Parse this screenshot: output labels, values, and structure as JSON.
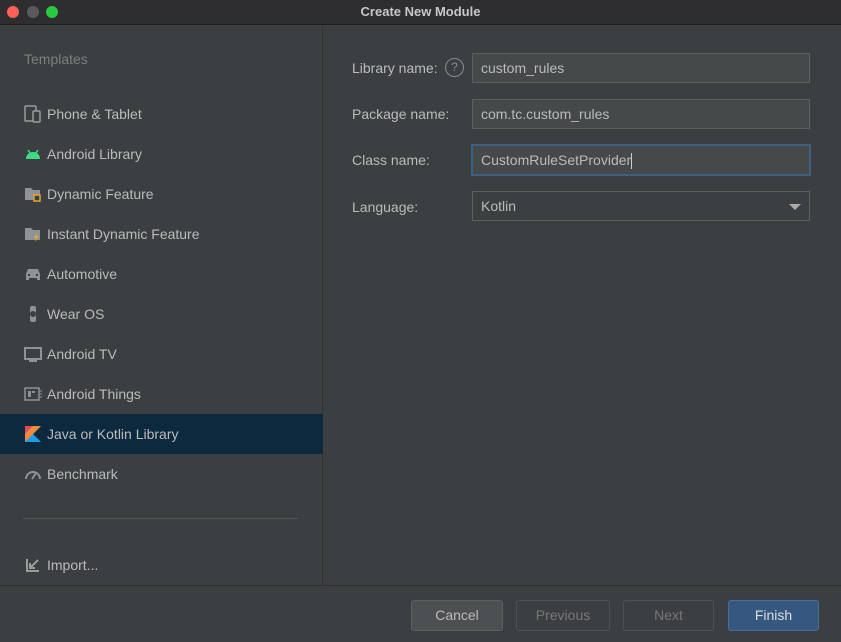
{
  "window": {
    "title": "Create New Module"
  },
  "sidebar": {
    "title": "Templates",
    "items": [
      {
        "label": "Phone & Tablet",
        "icon": "phone-tablet-icon"
      },
      {
        "label": "Android Library",
        "icon": "android-icon"
      },
      {
        "label": "Dynamic Feature",
        "icon": "dynamic-feature-folder-icon"
      },
      {
        "label": "Instant Dynamic Feature",
        "icon": "instant-feature-folder-icon"
      },
      {
        "label": "Automotive",
        "icon": "car-icon"
      },
      {
        "label": "Wear OS",
        "icon": "watch-icon"
      },
      {
        "label": "Android TV",
        "icon": "tv-icon"
      },
      {
        "label": "Android Things",
        "icon": "things-board-icon"
      },
      {
        "label": "Java or Kotlin Library",
        "icon": "kotlin-icon",
        "selected": true
      },
      {
        "label": "Benchmark",
        "icon": "gauge-icon"
      }
    ],
    "import_label": "Import..."
  },
  "form": {
    "library_name": {
      "label": "Library name:",
      "value": "custom_rules"
    },
    "package_name": {
      "label": "Package name:",
      "value": "com.tc.custom_rules"
    },
    "class_name": {
      "label": "Class name:",
      "value": "CustomRuleSetProvider"
    },
    "language": {
      "label": "Language:",
      "value": "Kotlin"
    }
  },
  "footer": {
    "cancel": "Cancel",
    "previous": "Previous",
    "next": "Next",
    "finish": "Finish"
  },
  "colors": {
    "accent": "#365880",
    "selection": "#0d293e"
  }
}
